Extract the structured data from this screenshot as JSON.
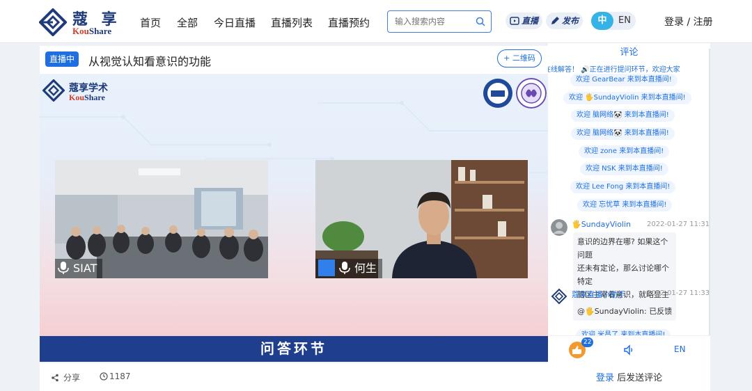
{
  "nav": {
    "logo_cn": "蔻 享",
    "logo_en_a": "Kou",
    "logo_en_b": "Share",
    "items": [
      "首页",
      "全部",
      "今日直播",
      "直播列表",
      "直播预约"
    ],
    "search_placeholder": "输入搜索内容",
    "live_pill": "直播",
    "publish_pill": "发布",
    "lang_zh": "中",
    "lang_en": "EN",
    "login": "登录 / 注册"
  },
  "live": {
    "badge": "直播中",
    "title": "从视觉认知看意识的功能",
    "qr_button": "+ 二维码"
  },
  "video": {
    "logo_cn": "蔻享学术",
    "logo_en_a": "Kou",
    "logo_en_b": "Share",
    "left_cam_label": "SIAT",
    "right_cam_label": "何生",
    "bottom_banner": "问答环节"
  },
  "meta": {
    "share": "分享",
    "views": "1187"
  },
  "panel": {
    "title": "评论",
    "ticker": "在线解答！ 🔊正在进行提问环节，欢迎大家",
    "welcomes": [
      "欢迎 GearBear 来到本直播间!",
      "欢迎 🖐SundayViolin 来到本直播间!",
      "欢迎 脑网络🐼 来到本直播间!",
      "欢迎 脑网络🐼 来到本直播间!",
      "欢迎 zone 来到本直播间!",
      "欢迎 NSK 来到本直播间!",
      "欢迎 Lee Fong 来到本直播间!",
      "欢迎 忘忧草 来到本直播间!"
    ],
    "comments": [
      {
        "user": "🖐SundayViolin",
        "time": "2022-01-27 11:31",
        "lines": [
          "意识的边界在哪? 如果这个问题",
          "还未有定论，那么讨论哪个特定",
          "脑区主宰着意识，就略显主观。"
        ]
      },
      {
        "user": "蔻享直播小助手",
        "time": "2022-01-27 11:33",
        "lines": [
          "@🖐SundayViolin: 已反馈"
        ]
      }
    ],
    "partial_welcome": "欢迎 米昌了 来到本直播间!",
    "like_count": "22",
    "en_button": "EN",
    "login_comment_a": "登录",
    "login_comment_b": " 后发送评论"
  },
  "colors": {
    "brand_navy": "#1f3b7a",
    "accent_blue": "#1f6fe0",
    "banner": "#1f3e8e",
    "like": "#f29a2e"
  }
}
